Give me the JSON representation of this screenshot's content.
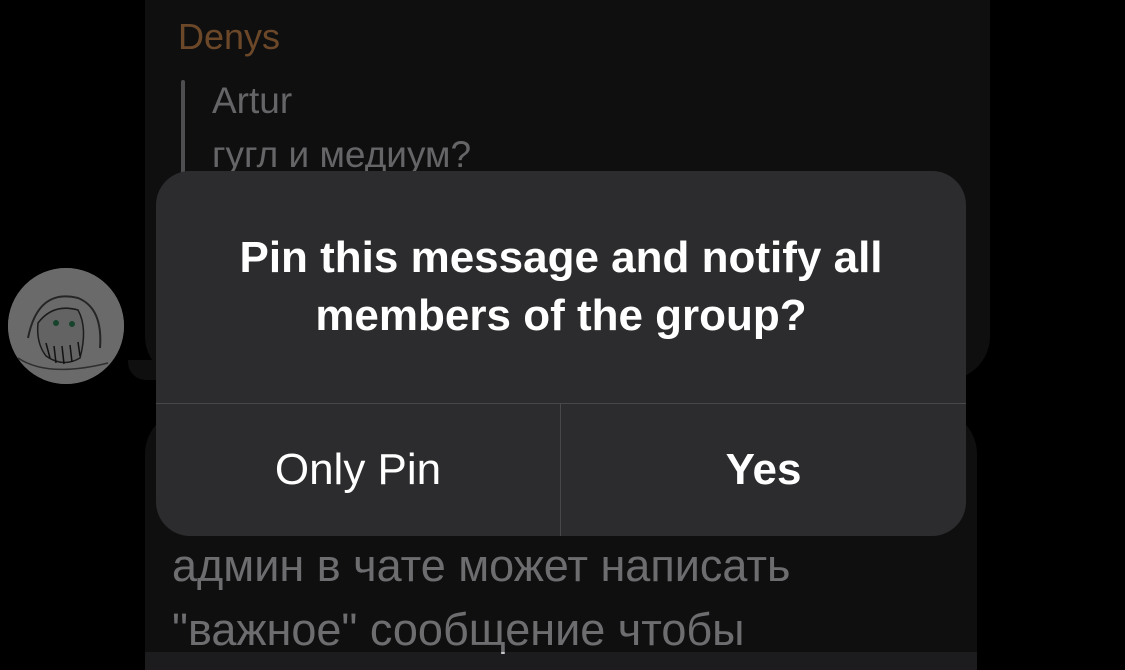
{
  "chat": {
    "message1": {
      "sender": "Denys",
      "reply": {
        "name": "Artur",
        "text": "гугл и медиум?"
      }
    },
    "message2": {
      "lines": [
        "админ в чате может написать",
        "\"важное\" сообщение чтобы"
      ]
    }
  },
  "alert": {
    "title": "Pin this message and notify all members of the group?",
    "only_pin_label": "Only Pin",
    "yes_label": "Yes"
  },
  "colors": {
    "sender_name": "#c5844c",
    "bubble": "#1c1c1e",
    "alert_bg": "#2c2c2e"
  }
}
